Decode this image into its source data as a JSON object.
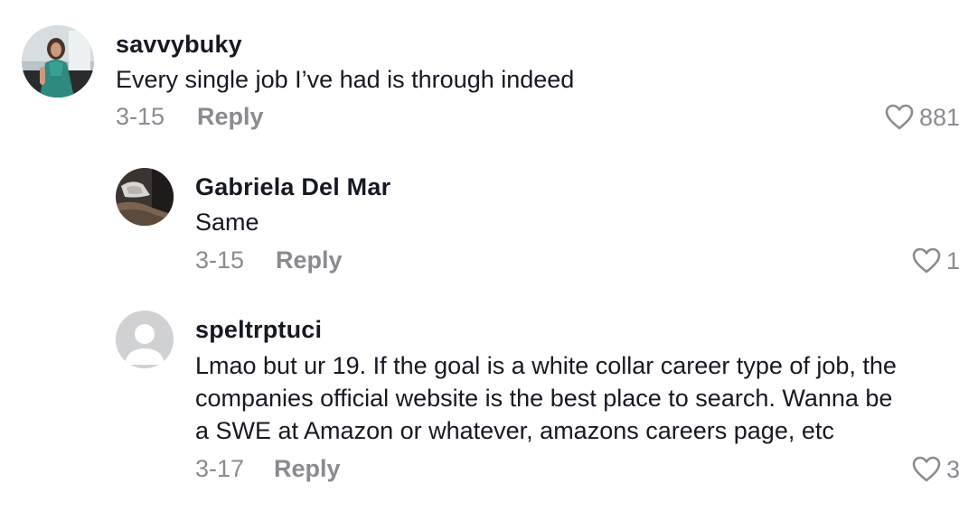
{
  "comments": [
    {
      "username": "savvybuky",
      "text_lines": [
        "Every single job I’ve had is through indeed"
      ],
      "date": "3-15",
      "reply_label": "Reply",
      "likes": "881"
    },
    {
      "username": "Gabriela Del Mar",
      "text_lines": [
        "Same"
      ],
      "date": "3-15",
      "reply_label": "Reply",
      "likes": "1"
    },
    {
      "username": "speltrptuci",
      "text_lines": [
        "Lmao but ur 19. If the goal is a white collar career type of job, the",
        "companies official website is the best place to search. Wanna be",
        "a SWE at Amazon or whatever, amazons careers page, etc"
      ],
      "date": "3-17",
      "reply_label": "Reply",
      "likes": "3"
    }
  ],
  "icons": {
    "like": "heart-outline-icon",
    "default_avatar": "default-avatar-icon"
  },
  "colors": {
    "text_primary": "#161823",
    "text_secondary": "#8a8b91",
    "default_avatar_bg": "#d0d1d3",
    "default_avatar_fg": "#ffffff"
  }
}
